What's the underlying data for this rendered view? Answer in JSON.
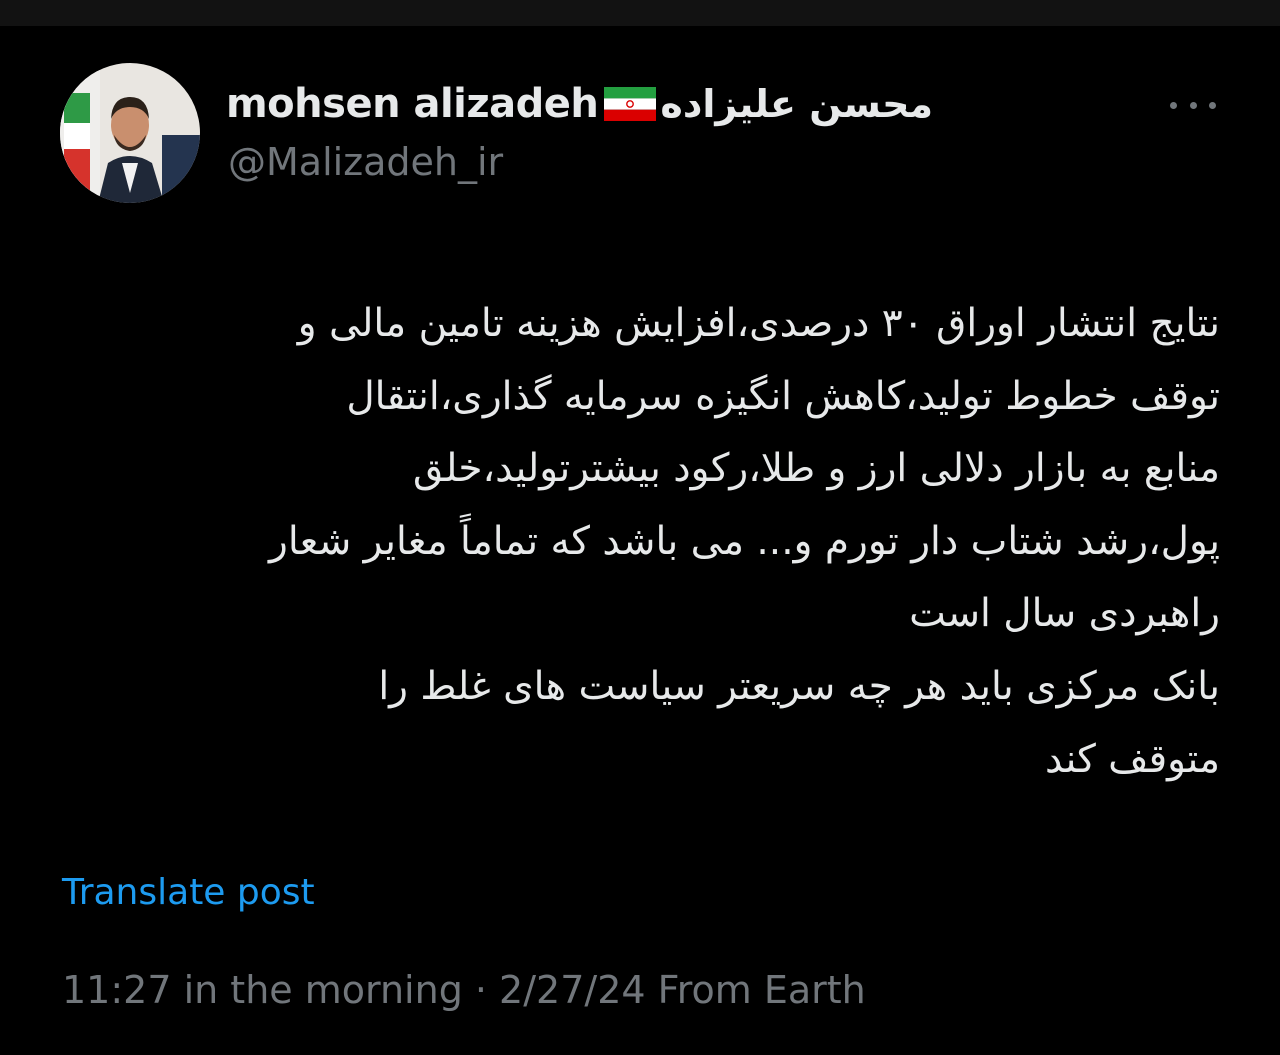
{
  "author": {
    "name_en": "mohsen alizadeh",
    "name_fa": "محسن علیزاده",
    "handle": "@Malizadeh_ir",
    "flag_icon": "iran-flag-icon"
  },
  "post": {
    "lines": [
      "نتایج انتشار اوراق ۳۰ درصدی،افزایش هزینه تامین مالی و",
      "توقف خطوط تولید،کاهش انگیزه سرمایه گذاری،انتقال",
      "منابع به بازار دلالی ارز و طلا،رکود بیشترتولید،خلق",
      "پول،رشد شتاب دار تورم و... می باشد که تماماً مغایر شعار",
      "راهبردی سال است",
      "بانک مرکزی باید هر چه سریعتر سیاست های غلط را",
      "متوقف کند"
    ],
    "translate_label": "Translate post",
    "timestamp": "11:27 in the morning · 2/27/24 From Earth"
  },
  "colors": {
    "background": "#000000",
    "text": "#e7e9ea",
    "muted": "#71767b",
    "link": "#1d9bf0"
  }
}
